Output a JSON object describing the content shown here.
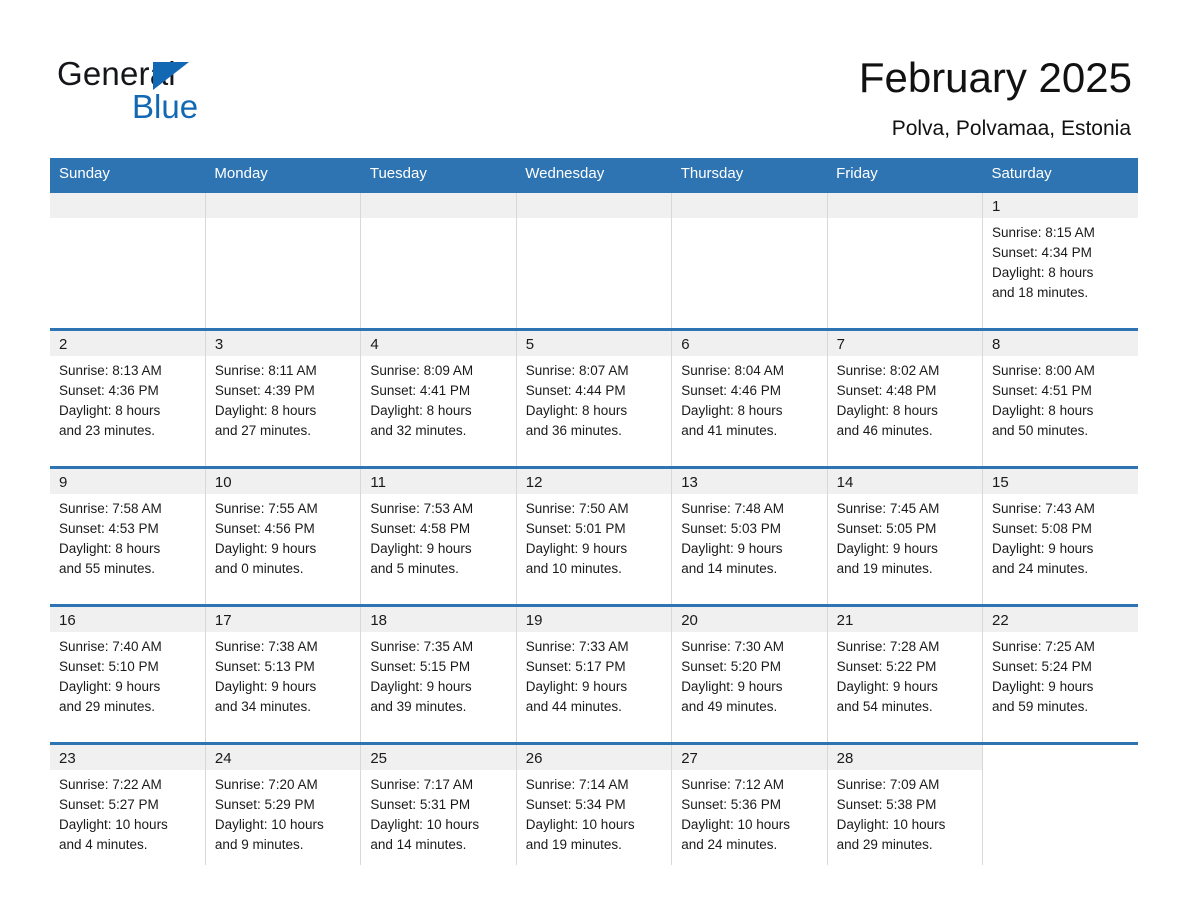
{
  "brand": {
    "name_part1": "General",
    "name_part2": "Blue",
    "accent_color": "#1268b3"
  },
  "header": {
    "title": "February 2025",
    "subtitle": "Polva, Polvamaa, Estonia"
  },
  "calendar": {
    "header_color": "#2e74b3",
    "weekday_headers": [
      "Sunday",
      "Monday",
      "Tuesday",
      "Wednesday",
      "Thursday",
      "Friday",
      "Saturday"
    ],
    "weeks": [
      [
        {
          "day": "",
          "blank": true
        },
        {
          "day": "",
          "blank": true
        },
        {
          "day": "",
          "blank": true
        },
        {
          "day": "",
          "blank": true
        },
        {
          "day": "",
          "blank": true
        },
        {
          "day": "",
          "blank": true
        },
        {
          "day": "1",
          "sunrise": "Sunrise: 8:15 AM",
          "sunset": "Sunset: 4:34 PM",
          "daylight1": "Daylight: 8 hours",
          "daylight2": "and 18 minutes."
        }
      ],
      [
        {
          "day": "2",
          "sunrise": "Sunrise: 8:13 AM",
          "sunset": "Sunset: 4:36 PM",
          "daylight1": "Daylight: 8 hours",
          "daylight2": "and 23 minutes."
        },
        {
          "day": "3",
          "sunrise": "Sunrise: 8:11 AM",
          "sunset": "Sunset: 4:39 PM",
          "daylight1": "Daylight: 8 hours",
          "daylight2": "and 27 minutes."
        },
        {
          "day": "4",
          "sunrise": "Sunrise: 8:09 AM",
          "sunset": "Sunset: 4:41 PM",
          "daylight1": "Daylight: 8 hours",
          "daylight2": "and 32 minutes."
        },
        {
          "day": "5",
          "sunrise": "Sunrise: 8:07 AM",
          "sunset": "Sunset: 4:44 PM",
          "daylight1": "Daylight: 8 hours",
          "daylight2": "and 36 minutes."
        },
        {
          "day": "6",
          "sunrise": "Sunrise: 8:04 AM",
          "sunset": "Sunset: 4:46 PM",
          "daylight1": "Daylight: 8 hours",
          "daylight2": "and 41 minutes."
        },
        {
          "day": "7",
          "sunrise": "Sunrise: 8:02 AM",
          "sunset": "Sunset: 4:48 PM",
          "daylight1": "Daylight: 8 hours",
          "daylight2": "and 46 minutes."
        },
        {
          "day": "8",
          "sunrise": "Sunrise: 8:00 AM",
          "sunset": "Sunset: 4:51 PM",
          "daylight1": "Daylight: 8 hours",
          "daylight2": "and 50 minutes."
        }
      ],
      [
        {
          "day": "9",
          "sunrise": "Sunrise: 7:58 AM",
          "sunset": "Sunset: 4:53 PM",
          "daylight1": "Daylight: 8 hours",
          "daylight2": "and 55 minutes."
        },
        {
          "day": "10",
          "sunrise": "Sunrise: 7:55 AM",
          "sunset": "Sunset: 4:56 PM",
          "daylight1": "Daylight: 9 hours",
          "daylight2": "and 0 minutes."
        },
        {
          "day": "11",
          "sunrise": "Sunrise: 7:53 AM",
          "sunset": "Sunset: 4:58 PM",
          "daylight1": "Daylight: 9 hours",
          "daylight2": "and 5 minutes."
        },
        {
          "day": "12",
          "sunrise": "Sunrise: 7:50 AM",
          "sunset": "Sunset: 5:01 PM",
          "daylight1": "Daylight: 9 hours",
          "daylight2": "and 10 minutes."
        },
        {
          "day": "13",
          "sunrise": "Sunrise: 7:48 AM",
          "sunset": "Sunset: 5:03 PM",
          "daylight1": "Daylight: 9 hours",
          "daylight2": "and 14 minutes."
        },
        {
          "day": "14",
          "sunrise": "Sunrise: 7:45 AM",
          "sunset": "Sunset: 5:05 PM",
          "daylight1": "Daylight: 9 hours",
          "daylight2": "and 19 minutes."
        },
        {
          "day": "15",
          "sunrise": "Sunrise: 7:43 AM",
          "sunset": "Sunset: 5:08 PM",
          "daylight1": "Daylight: 9 hours",
          "daylight2": "and 24 minutes."
        }
      ],
      [
        {
          "day": "16",
          "sunrise": "Sunrise: 7:40 AM",
          "sunset": "Sunset: 5:10 PM",
          "daylight1": "Daylight: 9 hours",
          "daylight2": "and 29 minutes."
        },
        {
          "day": "17",
          "sunrise": "Sunrise: 7:38 AM",
          "sunset": "Sunset: 5:13 PM",
          "daylight1": "Daylight: 9 hours",
          "daylight2": "and 34 minutes."
        },
        {
          "day": "18",
          "sunrise": "Sunrise: 7:35 AM",
          "sunset": "Sunset: 5:15 PM",
          "daylight1": "Daylight: 9 hours",
          "daylight2": "and 39 minutes."
        },
        {
          "day": "19",
          "sunrise": "Sunrise: 7:33 AM",
          "sunset": "Sunset: 5:17 PM",
          "daylight1": "Daylight: 9 hours",
          "daylight2": "and 44 minutes."
        },
        {
          "day": "20",
          "sunrise": "Sunrise: 7:30 AM",
          "sunset": "Sunset: 5:20 PM",
          "daylight1": "Daylight: 9 hours",
          "daylight2": "and 49 minutes."
        },
        {
          "day": "21",
          "sunrise": "Sunrise: 7:28 AM",
          "sunset": "Sunset: 5:22 PM",
          "daylight1": "Daylight: 9 hours",
          "daylight2": "and 54 minutes."
        },
        {
          "day": "22",
          "sunrise": "Sunrise: 7:25 AM",
          "sunset": "Sunset: 5:24 PM",
          "daylight1": "Daylight: 9 hours",
          "daylight2": "and 59 minutes."
        }
      ],
      [
        {
          "day": "23",
          "sunrise": "Sunrise: 7:22 AM",
          "sunset": "Sunset: 5:27 PM",
          "daylight1": "Daylight: 10 hours",
          "daylight2": "and 4 minutes."
        },
        {
          "day": "24",
          "sunrise": "Sunrise: 7:20 AM",
          "sunset": "Sunset: 5:29 PM",
          "daylight1": "Daylight: 10 hours",
          "daylight2": "and 9 minutes."
        },
        {
          "day": "25",
          "sunrise": "Sunrise: 7:17 AM",
          "sunset": "Sunset: 5:31 PM",
          "daylight1": "Daylight: 10 hours",
          "daylight2": "and 14 minutes."
        },
        {
          "day": "26",
          "sunrise": "Sunrise: 7:14 AM",
          "sunset": "Sunset: 5:34 PM",
          "daylight1": "Daylight: 10 hours",
          "daylight2": "and 19 minutes."
        },
        {
          "day": "27",
          "sunrise": "Sunrise: 7:12 AM",
          "sunset": "Sunset: 5:36 PM",
          "daylight1": "Daylight: 10 hours",
          "daylight2": "and 24 minutes."
        },
        {
          "day": "28",
          "sunrise": "Sunrise: 7:09 AM",
          "sunset": "Sunset: 5:38 PM",
          "daylight1": "Daylight: 10 hours",
          "daylight2": "and 29 minutes."
        },
        {
          "day": "",
          "blank": true
        }
      ]
    ]
  }
}
